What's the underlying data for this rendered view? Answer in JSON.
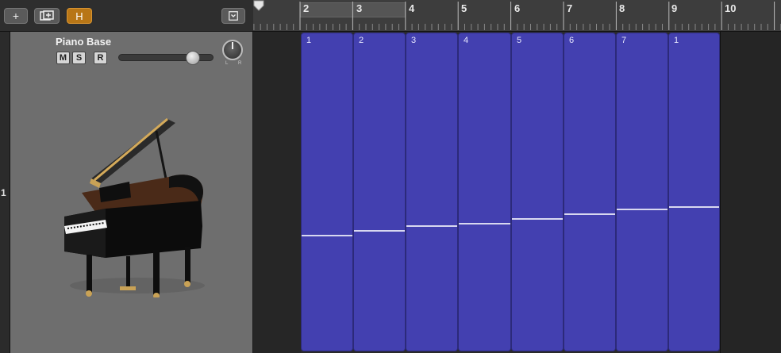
{
  "toolbar": {
    "add_glyph": "+",
    "h_label": "H"
  },
  "track": {
    "number": "1",
    "name": "Piano Base",
    "mute_label": "M",
    "solo_label": "S",
    "record_label": "R",
    "volume_fraction": 0.82,
    "pan_labels": {
      "left": "L",
      "right": "R"
    }
  },
  "ruler": {
    "bars": [
      "2",
      "3",
      "4",
      "5",
      "6",
      "7",
      "8",
      "9",
      "10"
    ]
  },
  "regions": [
    {
      "label": "1",
      "level": 0.36
    },
    {
      "label": "2",
      "level": 0.375
    },
    {
      "label": "3",
      "level": 0.39
    },
    {
      "label": "4",
      "level": 0.398
    },
    {
      "label": "5",
      "level": 0.413
    },
    {
      "label": "6",
      "level": 0.428
    },
    {
      "label": "7",
      "level": 0.443
    },
    {
      "label": "1",
      "level": 0.45
    }
  ],
  "colors": {
    "region": "#4340b0",
    "h_button": "#b87616"
  }
}
